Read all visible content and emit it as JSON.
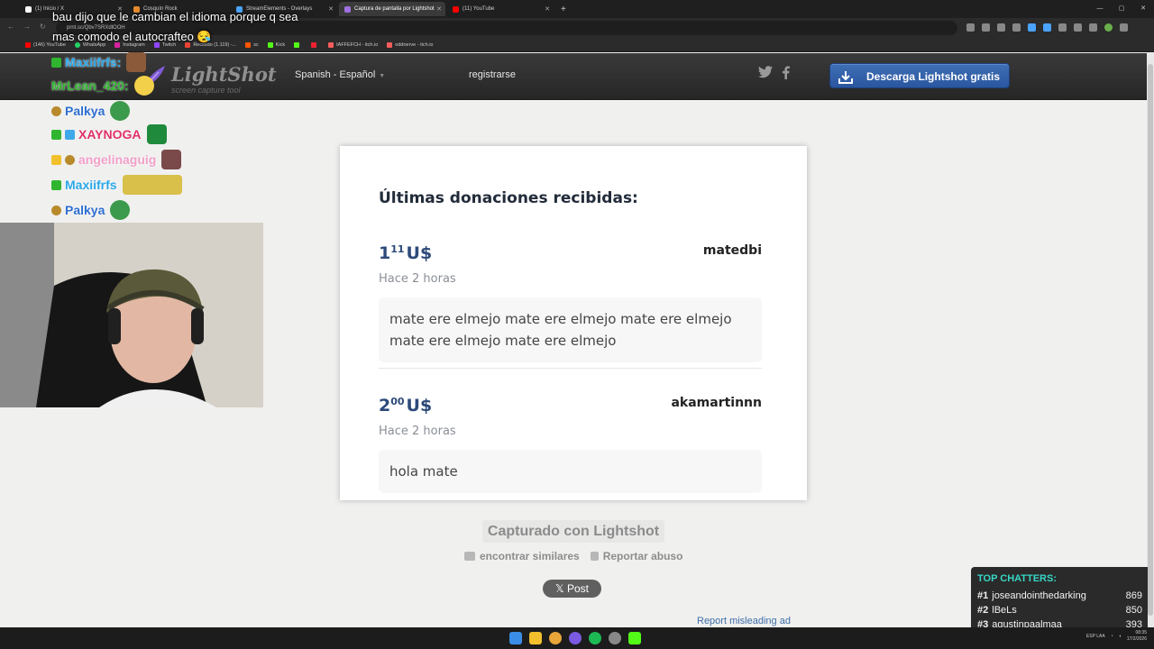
{
  "browser": {
    "tabs": [
      {
        "label": "(1) Inicio / X",
        "active": false
      },
      {
        "label": "Cosquín Rock",
        "active": false
      },
      {
        "label": "StreamElements - Overlays",
        "active": false
      },
      {
        "label": "Captura de pantalla por Lightshot",
        "active": true
      },
      {
        "label": "(11) YouTube",
        "active": false
      }
    ],
    "url": "prnt.sc/Qbv7SRXdlOOH",
    "bookmarks": [
      "(146) YouTube",
      "WhatsApp",
      "Instagram",
      "Twitch",
      "Recibido (1.119) -...",
      "sc",
      "Kick",
      "",
      "IAFFEFCH - itch.io",
      "oddnerve - itch.io"
    ],
    "window_controls": [
      "—",
      "▢",
      "✕"
    ]
  },
  "lightshot": {
    "logo_name": "LightShot",
    "logo_tagline": "screen capture tool",
    "language": "Spanish - Español",
    "register": "registrarse",
    "download_button": "Descarga Lightshot gratis",
    "captured_label": "Capturado con Lightshot",
    "find_similar": "encontrar similares",
    "report_abuse": "Reportar abuso",
    "post_button": "𝕏 Post",
    "misleading_ad": "Report misleading ad"
  },
  "card": {
    "title": "Últimas donaciones recibidas:",
    "donations": [
      {
        "amount_int": "1",
        "amount_dec": "11",
        "currency": "U$",
        "user": "matedbi",
        "time": "Hace 2 horas",
        "message": "mate ere elmejo mate ere elmejo mate ere elmejo mate ere elmejo mate ere elmejo"
      },
      {
        "amount_int": "2",
        "amount_dec": "00",
        "currency": "U$",
        "user": "akamartinnn",
        "time": "Hace 2 horas",
        "message": "hola mate"
      }
    ]
  },
  "overlay": {
    "caption_line1": "bau dijo que le cambian el idioma porque q sea",
    "caption_line2": "mas comodo el autocrafteo 😪",
    "chat": [
      {
        "nick": "Maxiifrfs:",
        "color": "#2aa8e8"
      },
      {
        "nick": "MrLean_420:",
        "color": "#2fb52f"
      },
      {
        "nick": "Palkya",
        "color": "#2f6fd1"
      },
      {
        "nick": "XAYNOGA",
        "color": "#e0306a"
      },
      {
        "nick": "angelinaguig",
        "color": "#f2a0c8"
      },
      {
        "nick": "Maxiifrfs",
        "color": "#2aa8e8"
      },
      {
        "nick": "Palkya",
        "color": "#2f6fd1"
      }
    ],
    "top_chatters": {
      "heading": "TOP CHATTERS:",
      "rows": [
        {
          "rank": "#1",
          "name": "joseandointhedarking",
          "count": "869"
        },
        {
          "rank": "#2",
          "name": "lBeLs",
          "count": "850"
        },
        {
          "rank": "#3",
          "name": "agustinpaalmaa",
          "count": "393"
        }
      ]
    }
  },
  "taskbar": {
    "lang": "ESP LAA",
    "time": "08:35",
    "date": "17/2/2026"
  }
}
